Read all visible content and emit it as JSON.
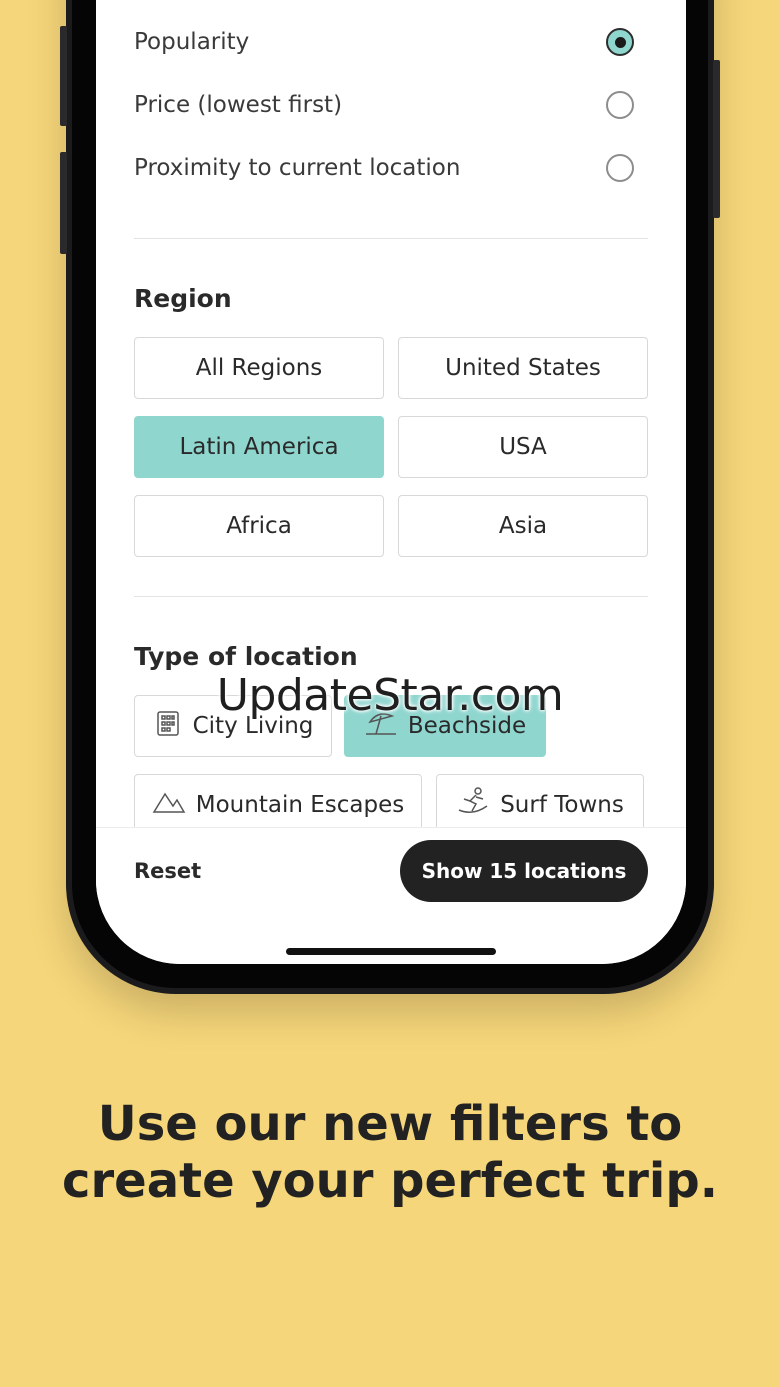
{
  "sort": {
    "options": [
      {
        "label": "Popularity",
        "selected": true
      },
      {
        "label": "Price (lowest first)",
        "selected": false
      },
      {
        "label": "Proximity to current location",
        "selected": false
      }
    ]
  },
  "region": {
    "title": "Region",
    "options": [
      {
        "label": "All Regions",
        "selected": false
      },
      {
        "label": "United States",
        "selected": false
      },
      {
        "label": "Latin America",
        "selected": true
      },
      {
        "label": "USA",
        "selected": false
      },
      {
        "label": "Africa",
        "selected": false
      },
      {
        "label": "Asia",
        "selected": false
      }
    ]
  },
  "location_type": {
    "title": "Type of location",
    "options": [
      {
        "label": "City Living",
        "icon": "building-icon",
        "selected": false
      },
      {
        "label": "Beachside",
        "icon": "beach-umbrella-icon",
        "selected": true
      },
      {
        "label": "Mountain Escapes",
        "icon": "mountain-icon",
        "selected": false
      },
      {
        "label": "Surf Towns",
        "icon": "surfer-icon",
        "selected": false
      }
    ]
  },
  "footer": {
    "reset_label": "Reset",
    "show_label": "Show 15 locations"
  },
  "watermark": "UpdateStar.com",
  "caption": {
    "line1": "Use our new filters to",
    "line2": "create your perfect trip."
  },
  "colors": {
    "background": "#F6D67A",
    "accent": "#8FD6CF",
    "button_dark": "#222222"
  }
}
